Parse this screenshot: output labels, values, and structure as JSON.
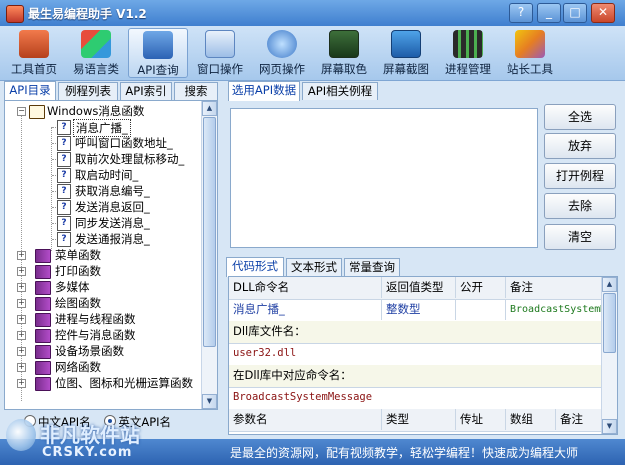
{
  "window": {
    "title": "最生易编程助手 V1.2",
    "btn_help": "?",
    "btn_min": "_",
    "btn_max": "□",
    "btn_close": "✕"
  },
  "toolbar": {
    "items": [
      {
        "label": "工具首页"
      },
      {
        "label": "易语言类"
      },
      {
        "label": "API查询"
      },
      {
        "label": "窗口操作"
      },
      {
        "label": "网页操作"
      },
      {
        "label": "屏幕取色"
      },
      {
        "label": "屏幕截图"
      },
      {
        "label": "进程管理"
      },
      {
        "label": "站长工具"
      }
    ]
  },
  "left_tabs": [
    {
      "label": "API目录"
    },
    {
      "label": "例程列表"
    },
    {
      "label": "API索引"
    },
    {
      "label": "搜索"
    }
  ],
  "tree": {
    "root": "Windows消息函数",
    "children": [
      "消息广播_",
      "呼叫窗口函数地址_",
      "取前次处理鼠标移动_",
      "取启动时间_",
      "获取消息编号_",
      "发送消息返回_",
      "同步发送消息_",
      "发送通报消息_"
    ],
    "groups": [
      "菜单函数",
      "打印函数",
      "多媒体",
      "绘图函数",
      "进程与线程函数",
      "控件与消息函数",
      "设备场景函数",
      "网络函数",
      "位图、图标和光栅运算函数"
    ]
  },
  "radio": {
    "opt1": "中文API名",
    "opt2": "英文API名"
  },
  "right_tabs": [
    {
      "label": "选用API数据"
    },
    {
      "label": "API相关例程"
    }
  ],
  "buttons": {
    "select_all": "全选",
    "discard": "放弃",
    "open_example": "打开例程",
    "remove": "去除",
    "clear": "清空"
  },
  "lower_tabs": [
    {
      "label": "代码形式"
    },
    {
      "label": "文本形式"
    },
    {
      "label": "常量查询"
    }
  ],
  "grid": {
    "headers": {
      "dll_cmd": "DLL命令名",
      "return_type": "返回值类型",
      "public": "公开",
      "note": "备注"
    },
    "row1": {
      "name": "消息广播_",
      "type": "整数型",
      "public": "",
      "note": "BroadcastSystemMessage"
    },
    "dll_lib_label": "Dll库文件名：",
    "dll_lib_value": "user32.dll",
    "func_name_label": "在Dll库中对应命令名：",
    "func_name_value": "BroadcastSystemMessage",
    "param_headers": {
      "name": "参数名",
      "type": "类型",
      "ref": "传址",
      "array": "数组",
      "note": "备注"
    }
  },
  "statusbar": {
    "text": "是最全的资源网，配有视频教学，轻松学编程！快速成为编程大师"
  },
  "watermark": {
    "cn": "非凡软件站",
    "en": "CRSKY.com"
  }
}
